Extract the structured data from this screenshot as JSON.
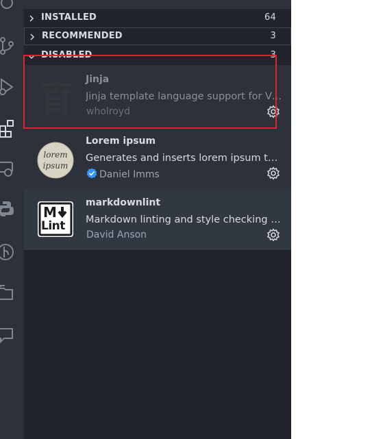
{
  "activity_bar": {
    "icons": [
      "search-icon",
      "source-control-icon",
      "run-debug-icon",
      "extensions-icon",
      "remote-explorer-icon",
      "python-icon",
      "git-graph-icon",
      "folder-icon",
      "comments-icon"
    ]
  },
  "sections": {
    "installed": {
      "label": "INSTALLED",
      "count": "64"
    },
    "recommended": {
      "label": "RECOMMENDED",
      "count": "3"
    },
    "disabled": {
      "label": "DISABLED",
      "count": "3"
    }
  },
  "extensions": [
    {
      "name": "Jinja",
      "description": "Jinja template language support for Visual Studio Code",
      "publisher": "wholroyd",
      "icon": "jinja-torii-icon"
    },
    {
      "name": "Lorem ipsum",
      "description": "Generates and inserts lorem ipsum text",
      "publisher": "Daniel Imms",
      "verified": true,
      "icon": "lorem-ipsum-icon",
      "icon_text_1": "lorem",
      "icon_text_2": "ipsum"
    },
    {
      "name": "markdownlint",
      "description": "Markdown linting and style checking for Visual Studio Code",
      "publisher": "David Anson",
      "icon": "markdownlint-icon",
      "icon_text_1": "M",
      "icon_text_2": "Lint"
    }
  ],
  "colors": {
    "sidebar_bg": "#21252b",
    "item_bg": "#2c313a",
    "text": "#d7dae0",
    "highlight": "#e0232f",
    "verified": "#3794ff"
  }
}
